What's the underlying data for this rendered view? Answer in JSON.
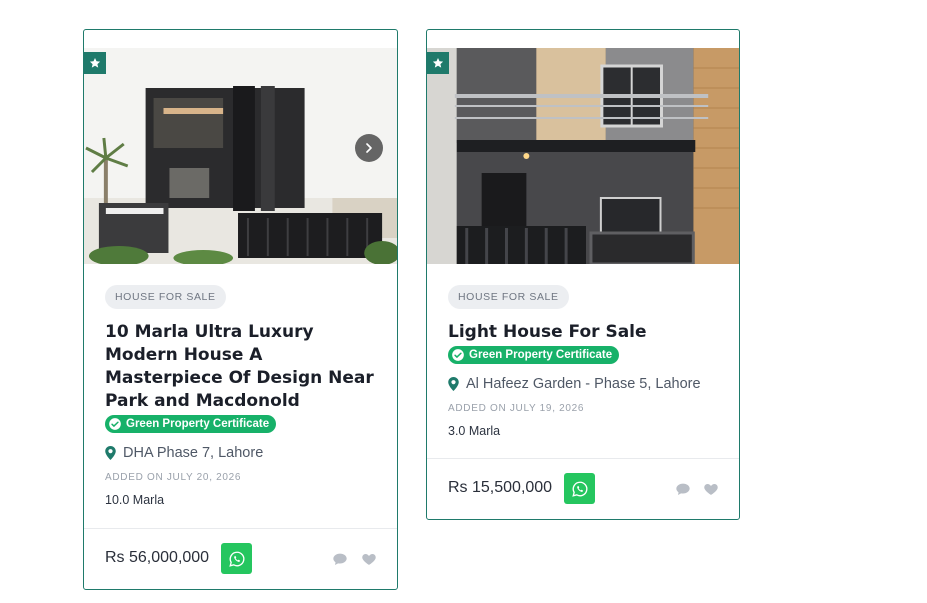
{
  "listings": [
    {
      "type_label": "HOUSE FOR SALE",
      "title": "10 Marla Ultra Luxury Modern House A Masterpiece Of Design Near Park and Macdonold",
      "certificate": "Green Property Certificate",
      "location": "DHA Phase 7, Lahore",
      "added": "ADDED ON JULY 20, 2026",
      "area": "10.0 Marla",
      "price": "Rs 56,000,000",
      "featured_icon": "star-icon",
      "has_next_arrow": true
    },
    {
      "type_label": "HOUSE FOR SALE",
      "title": "Light House For Sale",
      "certificate": "Green Property Certificate",
      "location": "Al Hafeez Garden - Phase 5, Lahore",
      "added": "ADDED ON JULY 19, 2026",
      "area": "3.0 Marla",
      "price": "Rs 15,500,000",
      "featured_icon": "star-icon",
      "has_next_arrow": false
    }
  ],
  "colors": {
    "accent": "#1f7a6b",
    "certificate": "#17b169",
    "whatsapp": "#25c65f",
    "muted_icon": "#b9bec6"
  }
}
